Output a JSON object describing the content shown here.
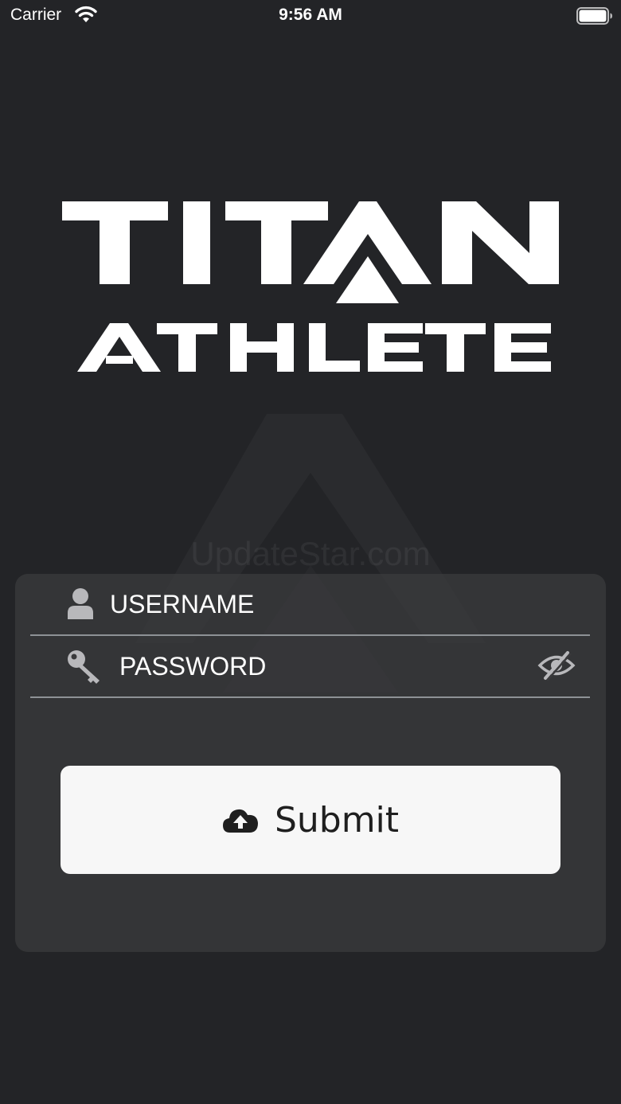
{
  "status_bar": {
    "carrier": "Carrier",
    "time": "9:56 AM",
    "icons": [
      "wifi-icon",
      "battery-icon"
    ]
  },
  "logo": {
    "line1": "TITAN",
    "line2": "ATHLETE"
  },
  "watermark": {
    "text": "UpdateStar.com"
  },
  "login": {
    "username_placeholder": "USERNAME",
    "password_placeholder": "PASSWORD",
    "username_icon": "user-icon",
    "password_icon": "key-icon",
    "toggle_icon": "eye-slash-icon",
    "submit_label": "Submit",
    "submit_icon": "cloud-upload-icon"
  },
  "colors": {
    "background": "#232427",
    "card": "#3a3a3c",
    "field_underline": "#8e9296",
    "button": "#f7f7f7",
    "button_text": "#1f1f1f",
    "text": "#ffffff"
  }
}
